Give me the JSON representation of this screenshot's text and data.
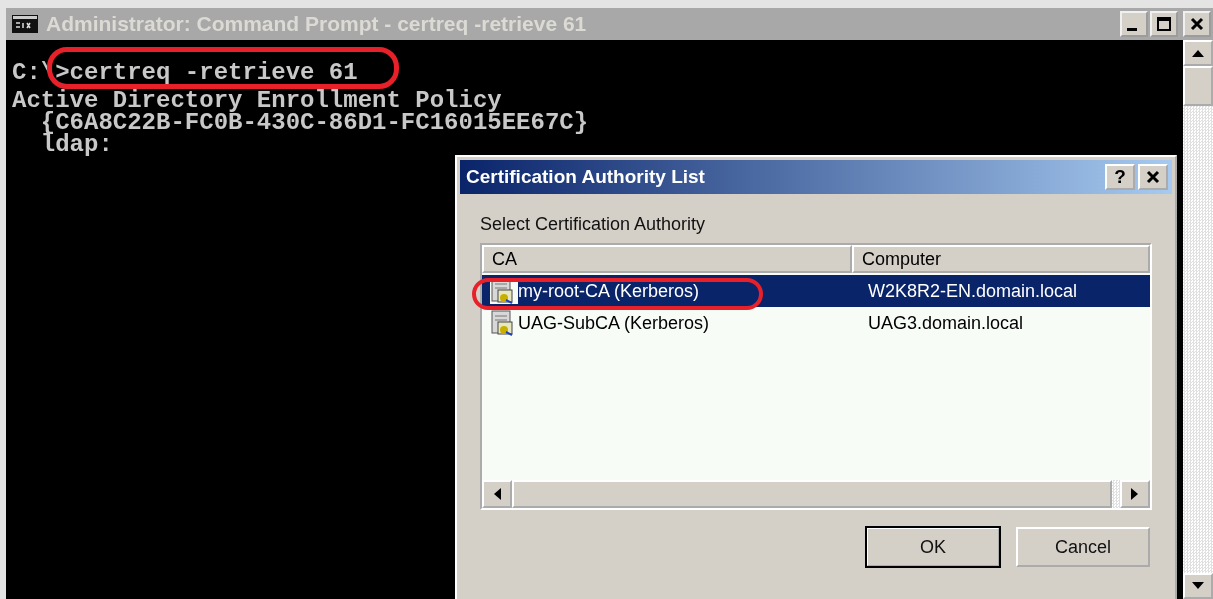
{
  "window": {
    "title": "Administrator: Command Prompt - certreq  -retrieve 61"
  },
  "console": {
    "lines": [
      "C:\\>certreq -retrieve 61",
      "Active Directory Enrollment Policy",
      "  {C6A8C22B-FC0B-430C-86D1-FC16015EE67C}",
      "  ldap:"
    ]
  },
  "dialog": {
    "title": "Certification Authority List",
    "help": "?",
    "label": "Select Certification Authority",
    "columns": [
      "CA",
      "Computer"
    ],
    "rows": [
      {
        "ca": "my-root-CA (Kerberos)",
        "computer": "W2K8R2-EN.domain.local",
        "selected": true
      },
      {
        "ca": "UAG-SubCA (Kerberos)",
        "computer": "UAG3.domain.local",
        "selected": false
      }
    ],
    "buttons": [
      {
        "label": "OK",
        "default": true
      },
      {
        "label": "Cancel",
        "default": false
      }
    ]
  }
}
